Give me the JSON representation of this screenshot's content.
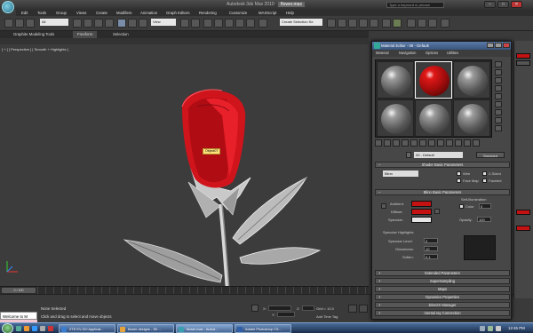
{
  "app": {
    "title": "Autodesk 3ds Max 2010",
    "file_name": "flower.max",
    "search_placeholder": "Type a keyword or phrase"
  },
  "menu": [
    "Edit",
    "Tools",
    "Group",
    "Views",
    "Create",
    "Modifiers",
    "Animation",
    "Graph Editors",
    "Rendering",
    "Customize",
    "MAXScript",
    "Help"
  ],
  "toolbar": {
    "selection_filter": "All",
    "ref_coord": "View",
    "named_sets": "Create Selection Se"
  },
  "ribbon": {
    "tabs": [
      "Graphite Modeling Tools",
      "Freeform",
      "Selection"
    ],
    "active_tab": "Freeform"
  },
  "viewport": {
    "label": "[ + ] [ Perspective ] [ Smooth + Highlights ]",
    "object_label": "Object07"
  },
  "timeline": {
    "slider": "0 / 100"
  },
  "status": {
    "welcome": "Welcome to M",
    "selection": "None Selected",
    "hint": "Click and drag to select and move objects",
    "x_label": "X:",
    "y_label": "Y:",
    "z_label": "Z:",
    "grid": "Grid = 10.0",
    "add_time_tag": "Add Time Tag"
  },
  "material_editor": {
    "title": "Material Editor - 09 - Default",
    "menu": [
      "Material",
      "Navigation",
      "Options",
      "Utilities"
    ],
    "material_name": "09 - Default",
    "material_type": "Standard",
    "shader_rollout": "Shader Basic Parameters",
    "shader": "Blinn",
    "wire": "Wire",
    "two_sided": "2-Sided",
    "face_map": "Face Map",
    "faceted": "Faceted",
    "blinn_rollout": "Blinn Basic Parameters",
    "self_illumination": "Self-Illumination",
    "color": "Color",
    "color_value": "0",
    "ambient": "Ambient:",
    "diffuse": "Diffuse:",
    "specular": "Specular:",
    "opacity": "Opacity:",
    "opacity_value": "100",
    "specular_highlights": "Specular Highlights",
    "specular_level": "Specular Level:",
    "specular_level_value": "0",
    "glossiness": "Glossiness:",
    "glossiness_value": "10",
    "soften": "Soften:",
    "soften_value": "0.1",
    "rollouts": [
      "Extended Parameters",
      "SuperSampling",
      "Maps",
      "Dynamics Properties",
      "DirectX Manager",
      "mental ray Connection"
    ],
    "colors": {
      "ambient": "#c41111",
      "diffuse": "#c41111",
      "specular": "#e6e6e6"
    }
  },
  "taskbar": {
    "tasks": [
      {
        "label": "ZTE EV-DO Applicat...",
        "color": "#3a7ccf"
      },
      {
        "label": "flower designs - 3D ...",
        "color": "#e7a33a"
      },
      {
        "label": "flower.max - Autod...",
        "color": "#3aa0b0"
      },
      {
        "label": "Adobe Photoshop CS...",
        "color": "#2e5fa8"
      }
    ],
    "clock": "12:45 PM"
  }
}
